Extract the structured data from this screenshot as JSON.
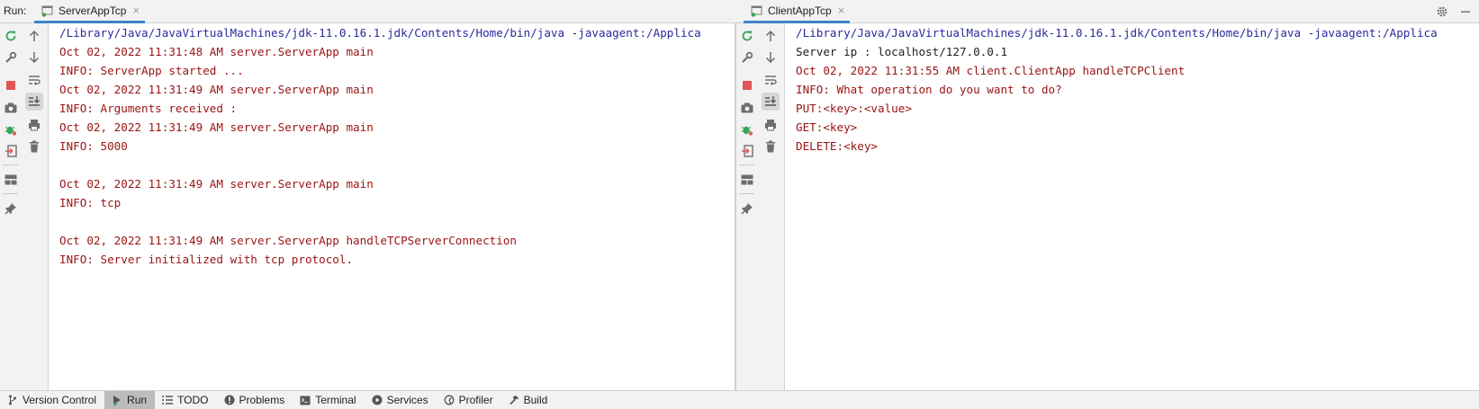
{
  "run_label": "Run:",
  "tabs": [
    {
      "label": "ServerAppTcp",
      "close": "×"
    },
    {
      "label": "ClientAppTcp",
      "close": "×"
    }
  ],
  "server_console": [
    {
      "kind": "cmd",
      "text": "/Library/Java/JavaVirtualMachines/jdk-11.0.16.1.jdk/Contents/Home/bin/java -javaagent:/Applica"
    },
    {
      "kind": "info",
      "text": "Oct 02, 2022 11:31:48 AM server.ServerApp main"
    },
    {
      "kind": "info",
      "text": "INFO: ServerApp started ..."
    },
    {
      "kind": "info",
      "text": "Oct 02, 2022 11:31:49 AM server.ServerApp main"
    },
    {
      "kind": "info",
      "text": "INFO: Arguments received :"
    },
    {
      "kind": "info",
      "text": "Oct 02, 2022 11:31:49 AM server.ServerApp main"
    },
    {
      "kind": "info",
      "text": "INFO: 5000"
    },
    {
      "kind": "info",
      "text": ""
    },
    {
      "kind": "info",
      "text": "Oct 02, 2022 11:31:49 AM server.ServerApp main"
    },
    {
      "kind": "info",
      "text": "INFO: tcp"
    },
    {
      "kind": "info",
      "text": ""
    },
    {
      "kind": "info",
      "text": "Oct 02, 2022 11:31:49 AM server.ServerApp handleTCPServerConnection"
    },
    {
      "kind": "info",
      "text": "INFO: Server initialized with tcp protocol."
    }
  ],
  "client_console": [
    {
      "kind": "cmd",
      "text": "/Library/Java/JavaVirtualMachines/jdk-11.0.16.1.jdk/Contents/Home/bin/java -javaagent:/Applica"
    },
    {
      "kind": "out",
      "text": "Server ip : localhost/127.0.0.1"
    },
    {
      "kind": "info",
      "text": "Oct 02, 2022 11:31:55 AM client.ClientApp handleTCPClient"
    },
    {
      "kind": "info",
      "text": "INFO: What operation do you want to do?"
    },
    {
      "kind": "info",
      "text": "PUT:<key>:<value>"
    },
    {
      "kind": "info",
      "text": "GET:<key>"
    },
    {
      "kind": "info",
      "text": "DELETE:<key>"
    }
  ],
  "status_bar": [
    {
      "label": "Version Control",
      "icon": "branch-icon"
    },
    {
      "label": "Run",
      "icon": "run-icon",
      "active": true
    },
    {
      "label": "TODO",
      "icon": "list-icon"
    },
    {
      "label": "Problems",
      "icon": "problems-icon"
    },
    {
      "label": "Terminal",
      "icon": "terminal-icon"
    },
    {
      "label": "Services",
      "icon": "services-icon"
    },
    {
      "label": "Profiler",
      "icon": "profiler-icon"
    },
    {
      "label": "Build",
      "icon": "hammer-icon"
    }
  ],
  "colors": {
    "command": "#2a2a9e",
    "info": "#9a1313",
    "stdout": "#1e1e1e",
    "stop": "#e05555",
    "rerun": "#3aa35b",
    "tab_underline": "#4083c9"
  }
}
